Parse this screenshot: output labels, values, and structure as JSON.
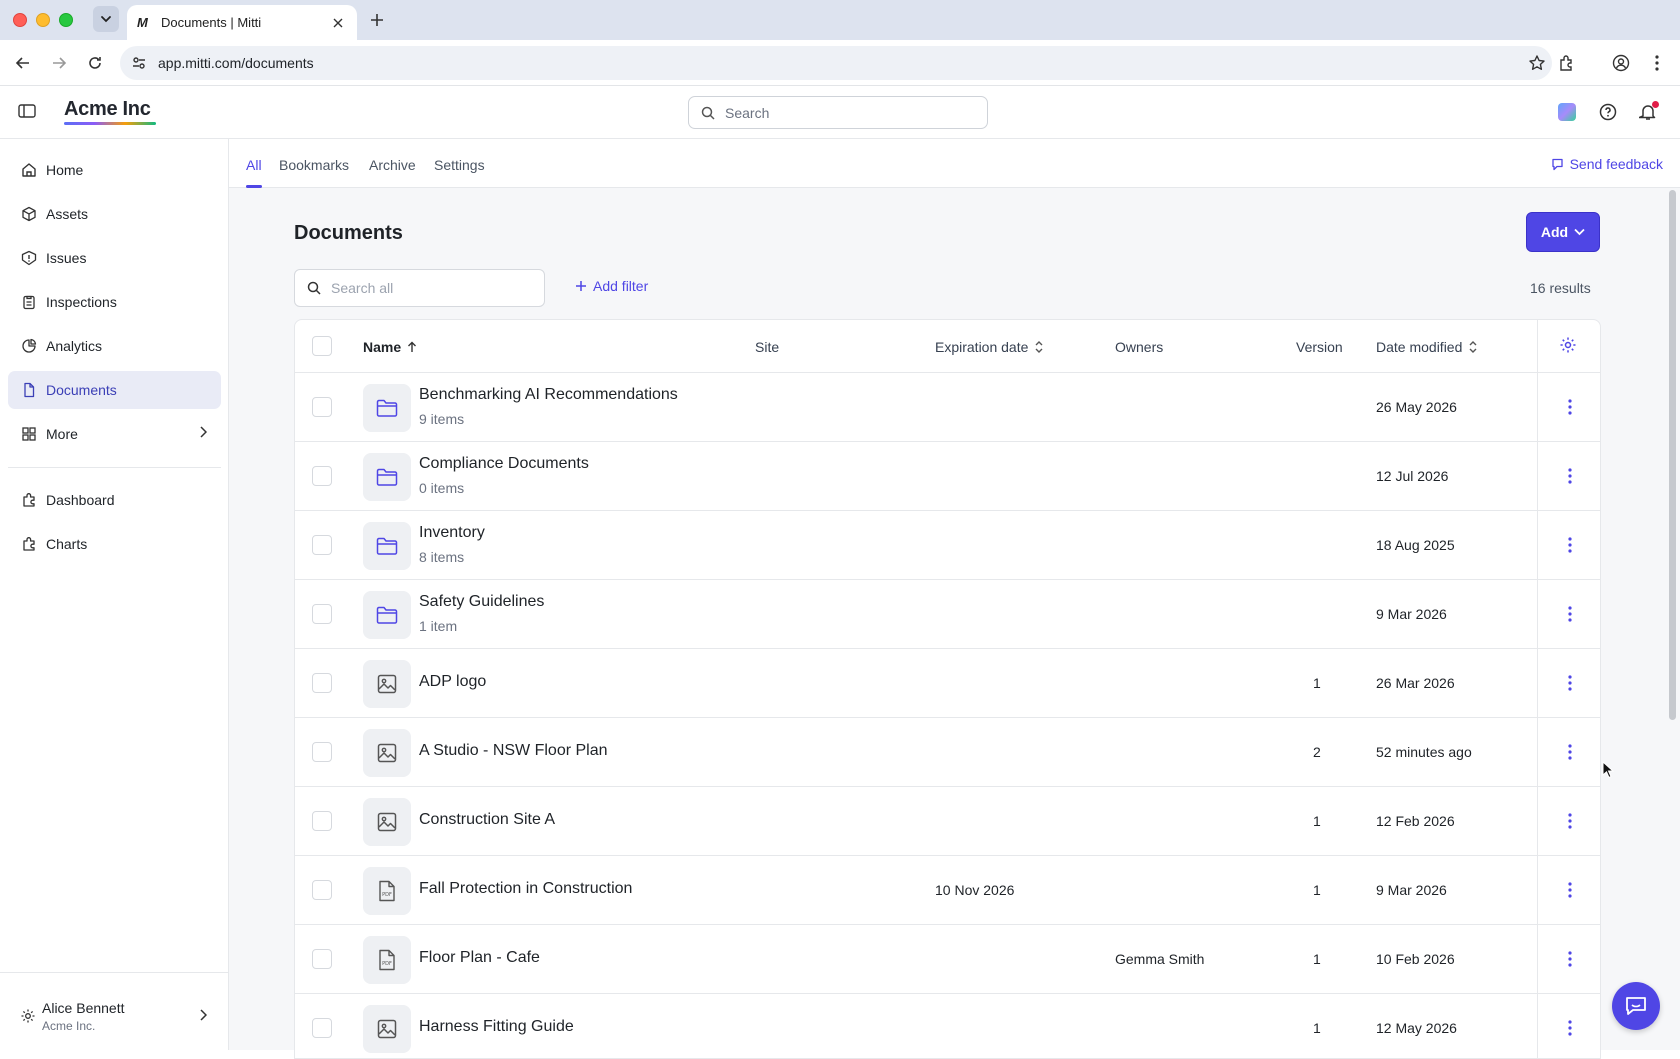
{
  "browser": {
    "tab_favicon": "M",
    "tab_title": "Documents | Mitti",
    "url": "app.mitti.com/documents"
  },
  "header": {
    "brand": "Acme Inc",
    "search_placeholder": "Search"
  },
  "sidebar": {
    "items": [
      {
        "label": "Home",
        "icon": "home-icon"
      },
      {
        "label": "Assets",
        "icon": "cube-icon"
      },
      {
        "label": "Issues",
        "icon": "alert-icon"
      },
      {
        "label": "Inspections",
        "icon": "clipboard-icon"
      },
      {
        "label": "Analytics",
        "icon": "pie-chart-icon"
      },
      {
        "label": "Documents",
        "icon": "document-icon",
        "active": true
      },
      {
        "label": "More",
        "icon": "grid-icon"
      }
    ],
    "secondary": [
      {
        "label": "Dashboard",
        "icon": "puzzle-icon"
      },
      {
        "label": "Charts",
        "icon": "puzzle-icon"
      }
    ],
    "user": {
      "name": "Alice Bennett",
      "org": "Acme Inc."
    }
  },
  "subtabs": [
    "All",
    "Bookmarks",
    "Archive",
    "Settings"
  ],
  "feedback_label": "Send feedback",
  "page": {
    "title": "Documents",
    "add_label": "Add",
    "search_placeholder": "Search all",
    "add_filter_label": "Add filter",
    "results": "16 results"
  },
  "table": {
    "columns": {
      "name": "Name",
      "site": "Site",
      "expiration": "Expiration date",
      "owners": "Owners",
      "version": "Version",
      "modified": "Date modified"
    },
    "rows": [
      {
        "type": "folder",
        "name": "Benchmarking AI Recommendations",
        "sub": "9 items",
        "expiration": "",
        "owners": "",
        "version": "",
        "modified": "26 May 2026"
      },
      {
        "type": "folder",
        "name": "Compliance Documents",
        "sub": "0 items",
        "expiration": "",
        "owners": "",
        "version": "",
        "modified": "12 Jul 2026"
      },
      {
        "type": "folder",
        "name": "Inventory",
        "sub": "8 items",
        "expiration": "",
        "owners": "",
        "version": "",
        "modified": "18 Aug 2025"
      },
      {
        "type": "folder",
        "name": "Safety Guidelines",
        "sub": "1 item",
        "expiration": "",
        "owners": "",
        "version": "",
        "modified": "9 Mar 2026"
      },
      {
        "type": "image",
        "name": "ADP logo",
        "sub": "",
        "expiration": "",
        "owners": "",
        "version": "1",
        "modified": "26 Mar 2026"
      },
      {
        "type": "image",
        "name": "A Studio - NSW Floor Plan",
        "sub": "",
        "expiration": "",
        "owners": "",
        "version": "2",
        "modified": "52 minutes ago"
      },
      {
        "type": "image",
        "name": "Construction Site A",
        "sub": "",
        "expiration": "",
        "owners": "",
        "version": "1",
        "modified": "12 Feb 2026"
      },
      {
        "type": "pdf",
        "name": "Fall Protection in Construction",
        "sub": "",
        "expiration": "10 Nov 2026",
        "owners": "",
        "version": "1",
        "modified": "9 Mar 2026"
      },
      {
        "type": "pdf",
        "name": "Floor Plan - Cafe",
        "sub": "",
        "expiration": "",
        "owners": "Gemma Smith",
        "version": "1",
        "modified": "10 Feb 2026"
      },
      {
        "type": "image",
        "name": "Harness Fitting Guide",
        "sub": "",
        "expiration": "",
        "owners": "",
        "version": "1",
        "modified": "12 May 2026"
      }
    ]
  },
  "colors": {
    "accent": "#4f46e5",
    "active_nav_bg": "#e9ebf6"
  }
}
